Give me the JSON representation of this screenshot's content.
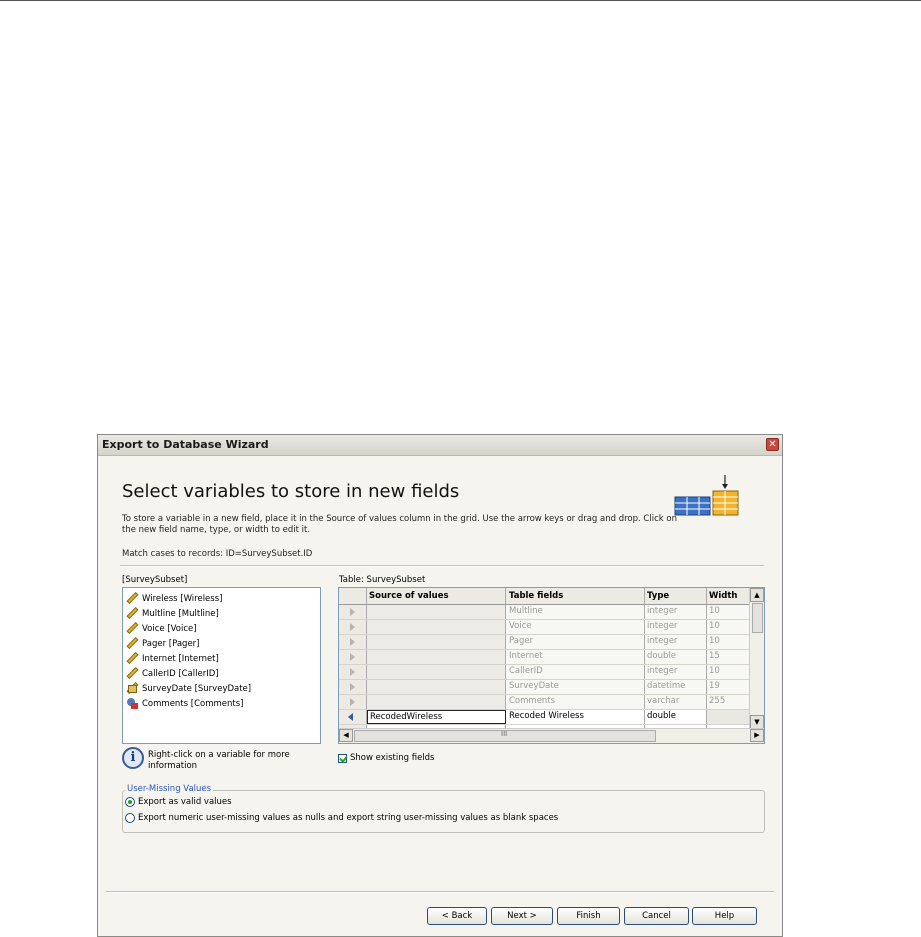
{
  "window": {
    "title": "Export to Database Wizard",
    "close_glyph": "✕"
  },
  "heading": "Select variables to store in new fields",
  "instructions": "To store a variable in a new field, place it in the Source of values column in the grid. Use the arrow keys or drag and drop. Click on the new field name, type, or width to edit it.",
  "match_text": "Match cases to records: ID=SurveySubset.ID",
  "source": {
    "label": "[SurveySubset]",
    "variables": [
      {
        "label": "Wireless [Wireless]",
        "icon": "ruler-scale-icon"
      },
      {
        "label": "Multline [Multline]",
        "icon": "ruler-scale-icon"
      },
      {
        "label": "Voice [Voice]",
        "icon": "ruler-scale-icon"
      },
      {
        "label": "Pager [Pager]",
        "icon": "ruler-scale-icon"
      },
      {
        "label": "Internet [Internet]",
        "icon": "ruler-scale-icon"
      },
      {
        "label": "CallerID [CallerID]",
        "icon": "ruler-scale-icon"
      },
      {
        "label": "SurveyDate [SurveyDate]",
        "icon": "date-scale-icon"
      },
      {
        "label": "Comments [Comments]",
        "icon": "string-nominal-icon"
      }
    ]
  },
  "info_text": "Right-click on a variable for more information",
  "table": {
    "label": "Table: SurveySubset",
    "headers": {
      "source": "Source of values",
      "fields": "Table fields",
      "type": "Type",
      "width": "Width"
    },
    "rows": [
      {
        "source": "",
        "field": "Multline",
        "type": "integer",
        "width": "10"
      },
      {
        "source": "",
        "field": "Voice",
        "type": "integer",
        "width": "10"
      },
      {
        "source": "",
        "field": "Pager",
        "type": "integer",
        "width": "10"
      },
      {
        "source": "",
        "field": "Internet",
        "type": "double",
        "width": "15"
      },
      {
        "source": "",
        "field": "CallerID",
        "type": "integer",
        "width": "10"
      },
      {
        "source": "",
        "field": "SurveyDate",
        "type": "datetime",
        "width": "19"
      },
      {
        "source": "",
        "field": "Comments",
        "type": "varchar",
        "width": "255"
      },
      {
        "source": "RecodedWireless",
        "field": "Recoded Wireless",
        "type": "double",
        "width": ""
      },
      {
        "source": "",
        "field": "",
        "type": "",
        "width": ""
      }
    ],
    "scroll_grip": "III"
  },
  "show_existing_label": "Show existing fields",
  "user_missing": {
    "title": "User-Missing Values",
    "options": [
      "Export as valid values",
      "Export numeric user-missing values as nulls and export string user-missing values as blank spaces"
    ],
    "selected": 0
  },
  "buttons": {
    "back": "< Back",
    "next": "Next >",
    "finish": "Finish",
    "cancel": "Cancel",
    "help": "Help"
  },
  "colors": {
    "grid_graphic_blue": "#3b72c4",
    "grid_graphic_yellow": "#f0b52c",
    "group_title": "#2b57b9"
  }
}
